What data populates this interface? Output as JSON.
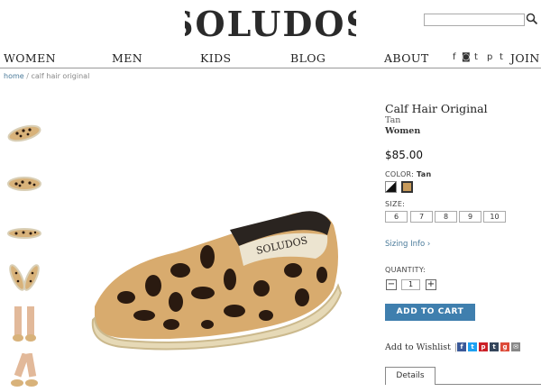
{
  "header": {
    "logo_text": "SOLUDOS",
    "search_placeholder": ""
  },
  "nav": {
    "items": [
      {
        "label": "WOMEN"
      },
      {
        "label": "MEN"
      },
      {
        "label": "KIDS"
      },
      {
        "label": "BLOG"
      },
      {
        "label": "ABOUT"
      }
    ],
    "social_icons": [
      "facebook-icon",
      "instagram-icon",
      "twitter-icon",
      "pinterest-icon",
      "tumblr-icon"
    ],
    "social_glyphs": [
      "f",
      "◙",
      "t",
      "p",
      "t"
    ],
    "join_label": "JOIN"
  },
  "breadcrumb": {
    "home": "home",
    "separator": "/",
    "current": "calf hair original"
  },
  "product": {
    "title": "Calf Hair Original",
    "color_name": "Tan",
    "gender": "Women",
    "price": "$85.00",
    "color_label": "COLOR:",
    "color_selected": "Tan",
    "size_label": "SIZE:",
    "sizes": [
      "6",
      "7",
      "8",
      "9",
      "10"
    ],
    "sizing_info": "Sizing Info ›",
    "quantity_label": "QUANTITY:",
    "quantity_value": "1",
    "minus": "−",
    "plus": "+",
    "add_to_cart": "ADD TO CART",
    "wishlist": "Add to Wishlist",
    "wishlist_sep": "|",
    "details_tab": "Details"
  },
  "share": [
    {
      "name": "facebook-share-icon",
      "glyph": "f",
      "color": "#3b5998"
    },
    {
      "name": "twitter-share-icon",
      "glyph": "t",
      "color": "#1da1f2"
    },
    {
      "name": "pinterest-share-icon",
      "glyph": "p",
      "color": "#cb2027"
    },
    {
      "name": "tumblr-share-icon",
      "glyph": "t",
      "color": "#35465c"
    },
    {
      "name": "googleplus-share-icon",
      "glyph": "g",
      "color": "#dd4b39"
    },
    {
      "name": "email-share-icon",
      "glyph": "✉",
      "color": "#888888"
    }
  ],
  "colors": {
    "link": "#4a7a9a",
    "cart_button": "#3f7fae"
  }
}
